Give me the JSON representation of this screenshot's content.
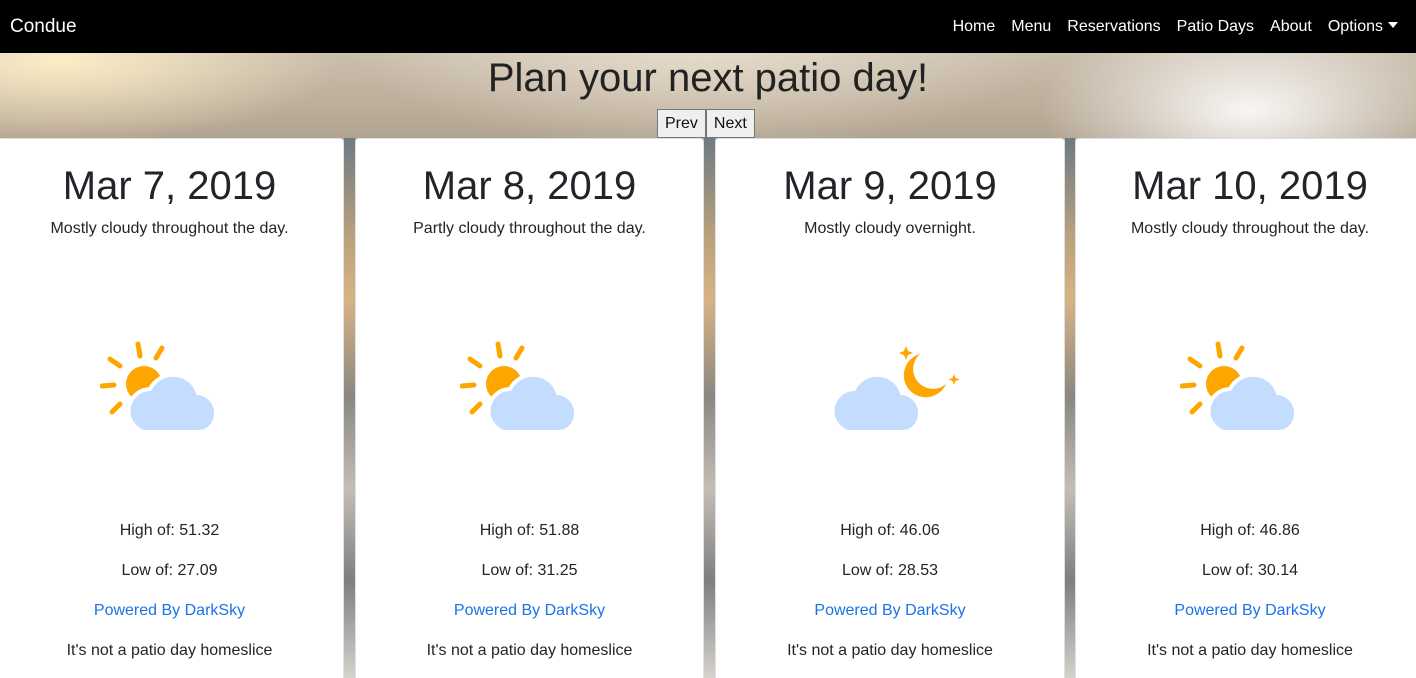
{
  "navbar": {
    "brand": "Condue",
    "links": [
      "Home",
      "Menu",
      "Reservations",
      "Patio Days",
      "About"
    ],
    "options_label": "Options"
  },
  "hero": {
    "title": "Plan your next patio day!",
    "prev_label": "Prev",
    "next_label": "Next"
  },
  "forecast": [
    {
      "date": "Mar 7, 2019",
      "summary": "Mostly cloudy throughout the day.",
      "icon": "partly-cloudy-day-icon",
      "high": "High of: 51.32",
      "low": "Low of: 27.09",
      "powered": "Powered By DarkSky",
      "verdict": "It's not a patio day homeslice"
    },
    {
      "date": "Mar 8, 2019",
      "summary": "Partly cloudy throughout the day.",
      "icon": "partly-cloudy-day-icon",
      "high": "High of: 51.88",
      "low": "Low of: 31.25",
      "powered": "Powered By DarkSky",
      "verdict": "It's not a patio day homeslice"
    },
    {
      "date": "Mar 9, 2019",
      "summary": "Mostly cloudy overnight.",
      "icon": "partly-cloudy-night-icon",
      "high": "High of: 46.06",
      "low": "Low of: 28.53",
      "powered": "Powered By DarkSky",
      "verdict": "It's not a patio day homeslice"
    },
    {
      "date": "Mar 10, 2019",
      "summary": "Mostly cloudy throughout the day.",
      "icon": "partly-cloudy-day-icon",
      "high": "High of: 46.86",
      "low": "Low of: 30.14",
      "powered": "Powered By DarkSky",
      "verdict": "It's not a patio day homeslice"
    }
  ],
  "colors": {
    "sun": "#FFA500",
    "cloud": "#C4DDFF",
    "link": "#1a73e8",
    "navbar": "#000000"
  }
}
